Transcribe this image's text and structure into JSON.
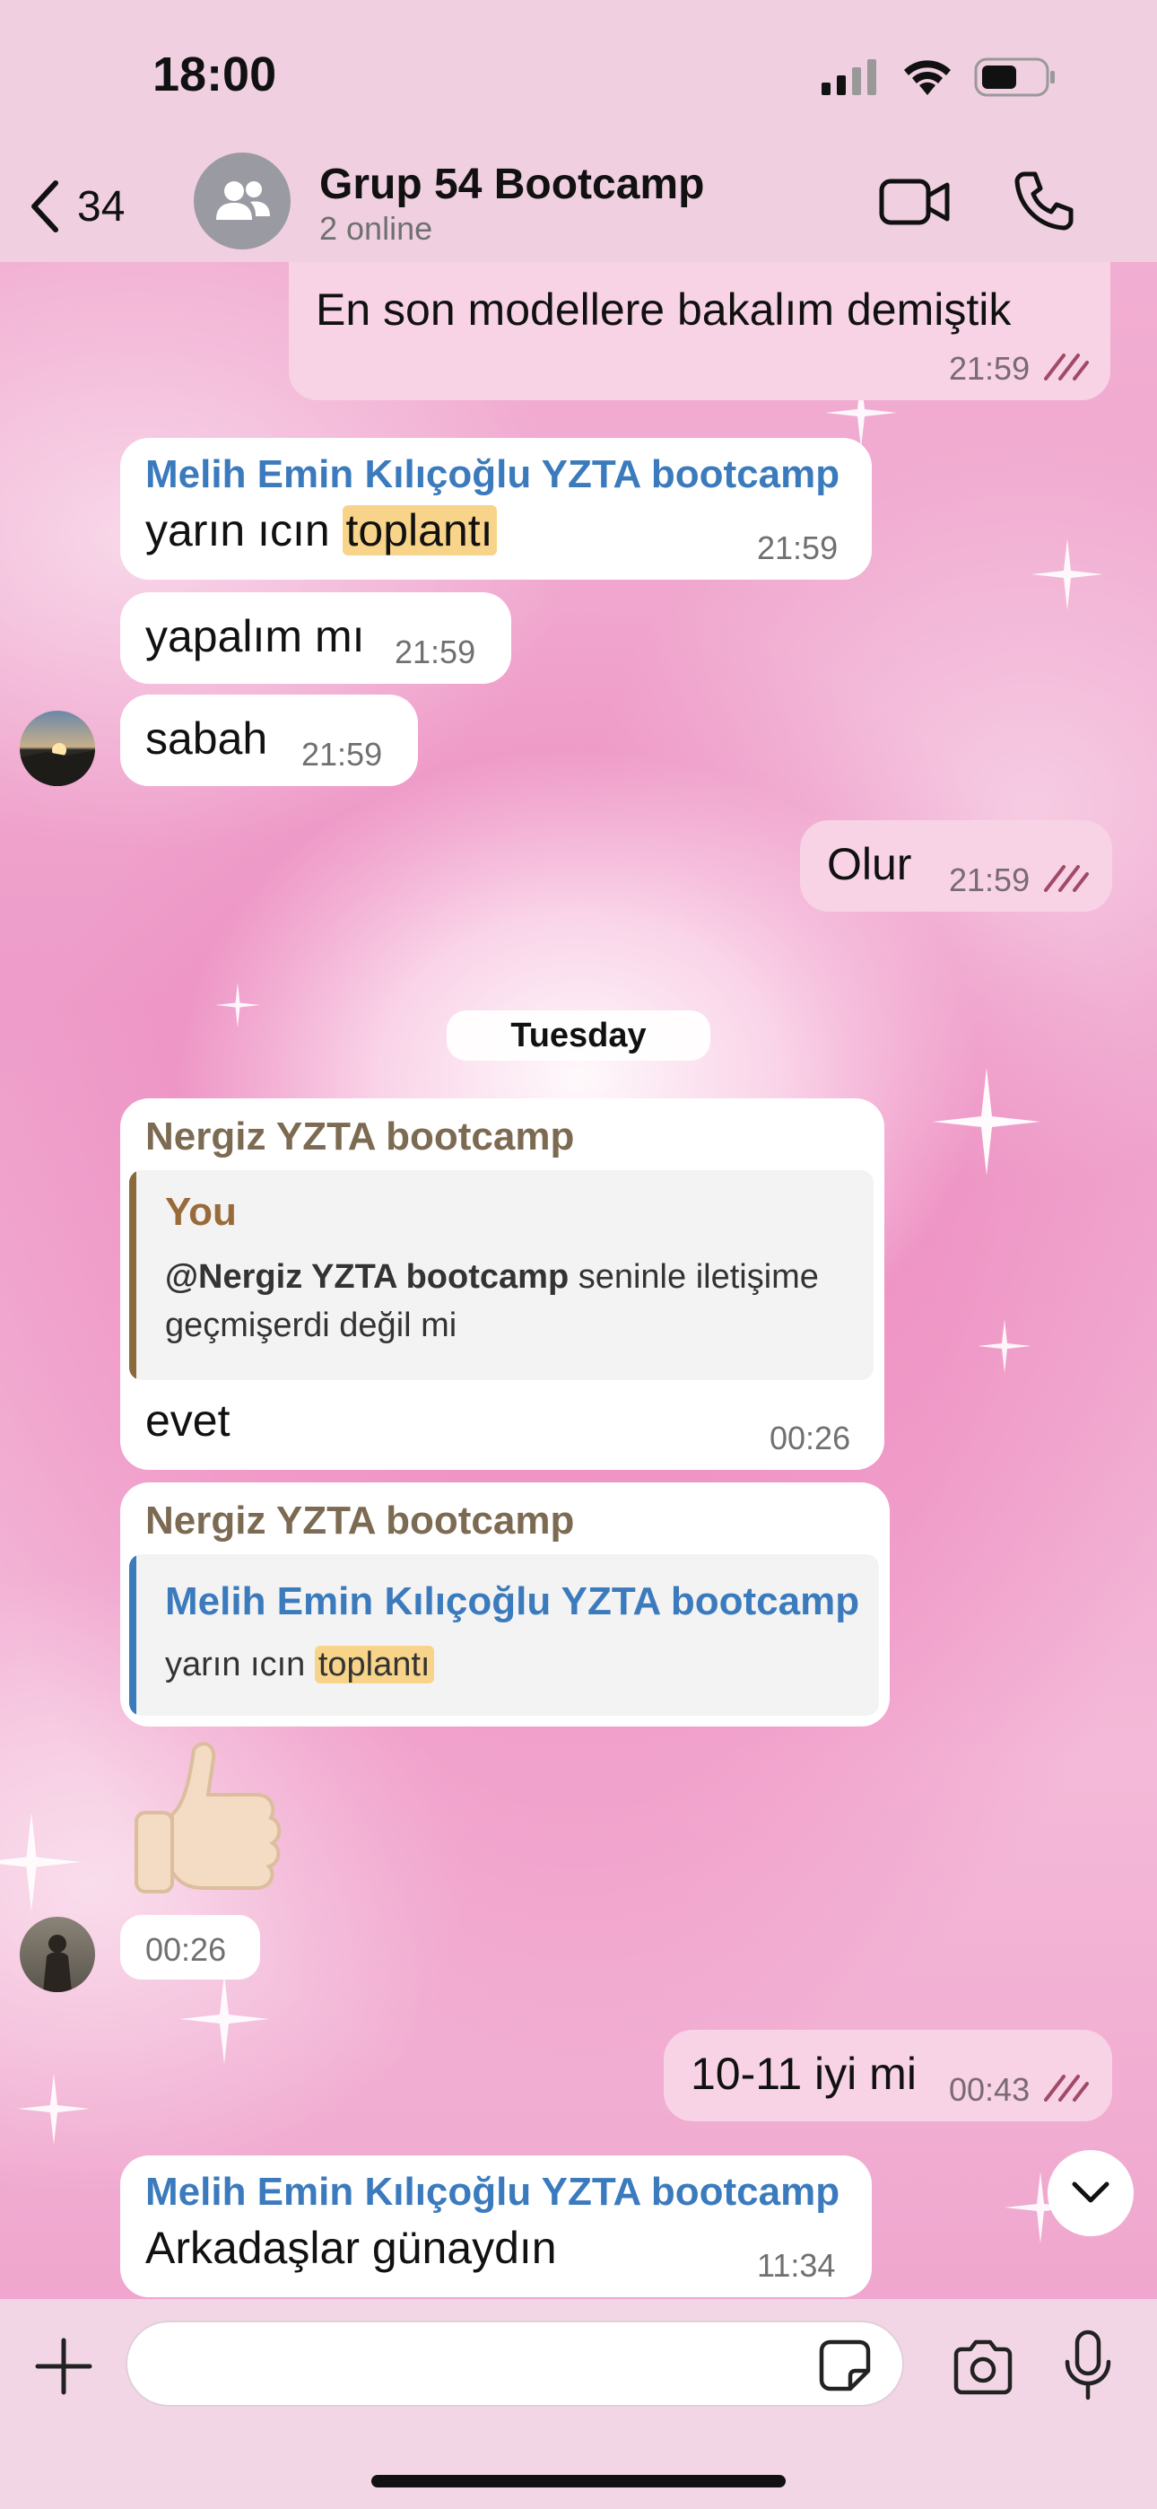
{
  "status_bar": {
    "time": "18:00"
  },
  "header": {
    "back_count": "34",
    "title": "Grup 54 Bootcamp",
    "subtitle": "2 online"
  },
  "messages": {
    "m1": {
      "text": "En son modellere bakalım demiştik",
      "time": "21:59",
      "direction": "outgoing",
      "status": "read"
    },
    "m2": {
      "sender": "Melih Emin Kılıçoğlu YZTA bootcamp",
      "text_before": "yarın ıcın ",
      "highlight": "toplantı",
      "time": "21:59",
      "direction": "incoming"
    },
    "m3": {
      "text": "yapalım mı",
      "time": "21:59",
      "direction": "incoming"
    },
    "m4": {
      "text": "sabah",
      "time": "21:59",
      "direction": "incoming"
    },
    "m5": {
      "text": "Olur",
      "time": "21:59",
      "direction": "outgoing",
      "status": "read"
    },
    "day_separator": "Tuesday",
    "m6": {
      "sender": "Nergiz YZTA bootcamp",
      "reply_name": "You",
      "reply_mention": "@Nergiz YZTA bootcamp",
      "reply_line1_rest": " seninle iletişime",
      "reply_line2": "geçmişerdi değil mi",
      "text": "evet",
      "time": "00:26",
      "direction": "incoming"
    },
    "m7": {
      "sender": "Nergiz YZTA bootcamp",
      "reply_name": "Melih Emin Kılıçoğlu YZTA bootcamp",
      "reply_text_before": "yarın ıcın ",
      "reply_highlight": "toplantı",
      "direction": "incoming"
    },
    "m8": {
      "emoji": "👍🏻",
      "time": "00:26",
      "direction": "incoming"
    },
    "m9": {
      "text": "10-11 iyi mi",
      "time": "00:43",
      "direction": "outgoing",
      "status": "read"
    },
    "m10": {
      "sender": "Melih Emin Kılıçoğlu YZTA bootcamp",
      "text": "Arkadaşlar günaydın",
      "time": "11:34",
      "direction": "incoming"
    }
  },
  "composer": {
    "placeholder": "",
    "value": ""
  },
  "colors": {
    "accent_blue": "#3b7bbd",
    "sender_brown": "#7d6a52",
    "highlight": "#f7d489",
    "outgoing_bubble": "#f7d3e5",
    "read_ticks": "#a14a66"
  },
  "icons": [
    "back-chevron-icon",
    "group-avatar-icon",
    "video-call-icon",
    "phone-icon",
    "double-check-icon",
    "chevron-down-icon",
    "plus-icon",
    "sticker-icon",
    "camera-icon",
    "microphone-icon",
    "signal-icon",
    "wifi-icon",
    "battery-icon"
  ]
}
